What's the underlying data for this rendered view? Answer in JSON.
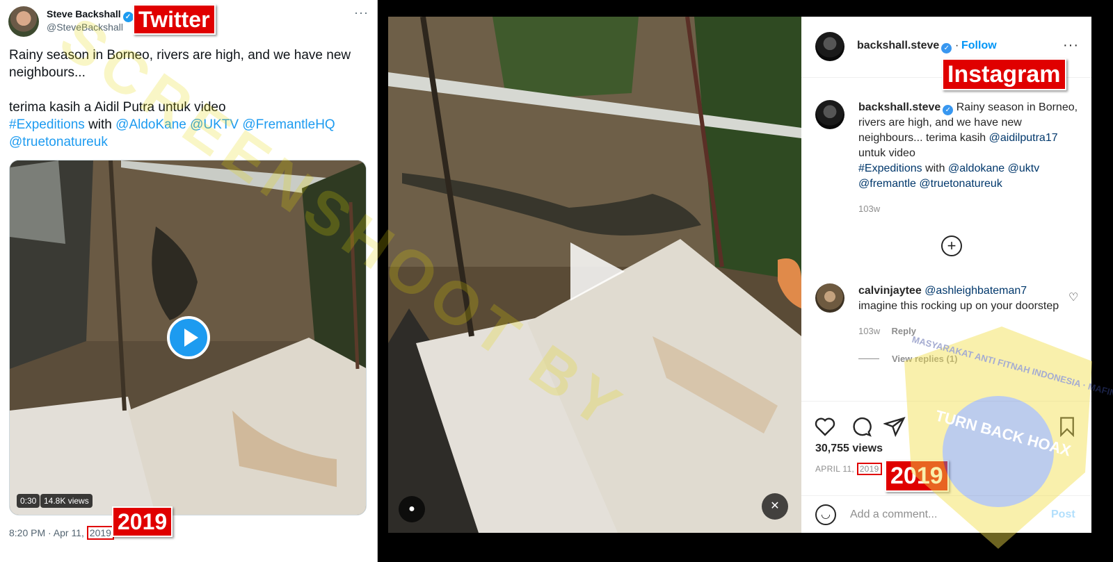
{
  "twitter": {
    "label": "Twitter",
    "name": "Steve Backshall",
    "handle": "@SteveBackshall",
    "more": "···",
    "text_line1": "Rainy season in Borneo, rivers are high, and we have new neighbours...",
    "text_line2": "terima kasih a Aidil Putra untuk video",
    "hashtag": "#Expeditions",
    "with": " with ",
    "mention1": "@AldoKane",
    "mention2": "@UKTV",
    "mention3": "@FremantleHQ",
    "mention4": "@truetonatureuk",
    "duration": "0:30",
    "views": "14.8K views",
    "time_prefix": "8:20 PM · Apr 11, ",
    "year": "2019",
    "year_label": "2019"
  },
  "instagram": {
    "label": "Instagram",
    "username": "backshall.steve",
    "follow": "Follow",
    "more": "···",
    "caption_text1": " Rainy season in Borneo, rivers are high, and we have new neighbours... terima kasih ",
    "caption_mention1": "@aidilputra17",
    "caption_text2": " untuk video ",
    "caption_hashtag": "#Expeditions",
    "caption_with": " with ",
    "caption_mention2": "@aldokane",
    "caption_mention3": "@uktv",
    "caption_mention4": "@fremantle",
    "caption_mention5": "@truetonatureuk",
    "caption_age": "103w",
    "comment_user": "calvinjaytee",
    "comment_mention": "@ashleighbateman7",
    "comment_text": " imagine this rocking up on your doorstep",
    "comment_age": "103w",
    "reply": "Reply",
    "view_replies": "View replies (1)",
    "views": "30,755 views",
    "date_prefix": "APRIL 11, ",
    "year": "2019",
    "year_label": "2019",
    "add_comment_placeholder": "Add a comment...",
    "post": "Post"
  },
  "watermark": {
    "diagonal_text": "SCREENSHOOT BY",
    "seal_text": "TURN BACK HOAX",
    "seal_ring": "MASYARAKAT ANTI FITNAH INDONESIA · MAFINDO"
  },
  "colors": {
    "twitter_blue": "#1d9bf0",
    "instagram_link": "#00376b",
    "follow_blue": "#0095f6",
    "label_red": "#e00000"
  }
}
